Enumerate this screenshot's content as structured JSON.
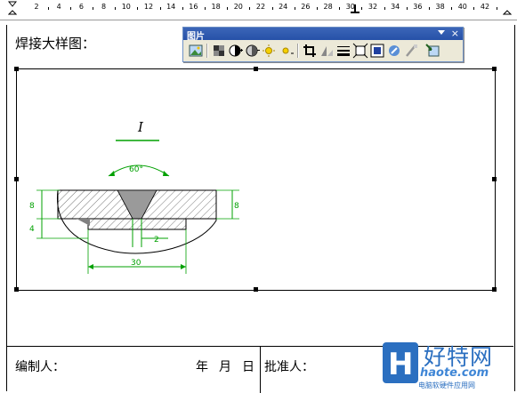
{
  "ruler": {
    "labels": [
      "2",
      "4",
      "6",
      "8",
      "10",
      "12",
      "14",
      "16",
      "18",
      "20",
      "22",
      "24",
      "26",
      "28",
      "30",
      "32",
      "34",
      "36",
      "38",
      "40",
      "42"
    ]
  },
  "document": {
    "heading": "焊接大样图：",
    "drawing": {
      "section_mark": "I",
      "angle_label": "60°",
      "dim_left_top": "8",
      "dim_left_bottom": "4",
      "dim_right": "8",
      "dim_gap": "2",
      "dim_bottom": "30"
    },
    "footer": {
      "compiled_by": "编制人：",
      "year": "年",
      "month": "月",
      "day": "日",
      "approved_by": "批准人："
    }
  },
  "toolbar": {
    "title": "图片",
    "close": "×",
    "buttons": [
      "insert-picture-icon",
      "color-icon",
      "more-contrast-icon",
      "less-contrast-icon",
      "more-brightness-icon",
      "less-brightness-icon",
      "crop-icon",
      "rotate-icon",
      "line-style-icon",
      "compress-icon",
      "text-wrapping-icon",
      "format-picture-icon",
      "set-transparent-color-icon",
      "reset-picture-icon"
    ]
  },
  "watermark": {
    "logo_text": "好特网",
    "url": "haote.com",
    "subtitle": "电脑软硬件应用网"
  },
  "colors": {
    "dimension": "#00a000",
    "toolbar_title": "#2a55ab",
    "watermark": "#2b6fc0"
  }
}
